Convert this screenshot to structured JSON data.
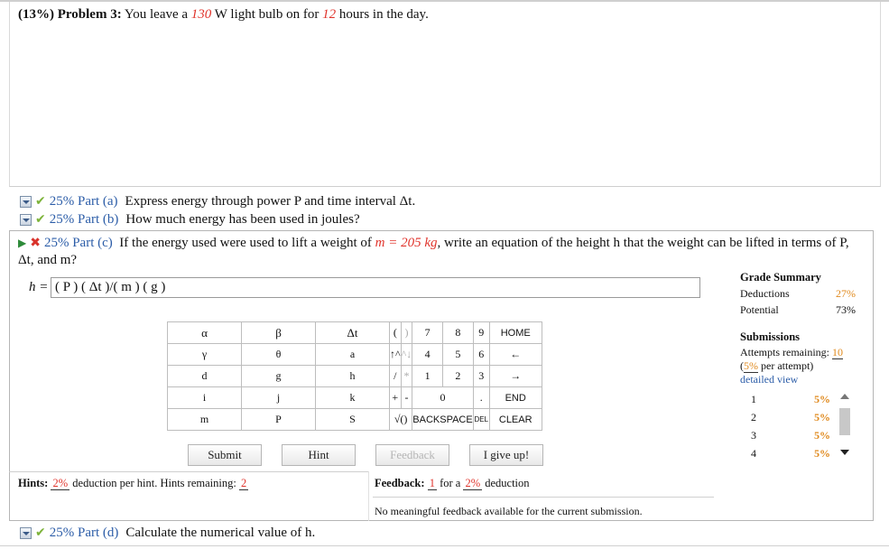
{
  "problem": {
    "label": "(13%) Problem 3:",
    "text_before": "You leave a",
    "power_value": "130",
    "text_mid": "W light bulb on for",
    "hours_value": "12",
    "text_after": "hours in the day."
  },
  "parts": {
    "a": {
      "pct": "25% Part (a)",
      "text": "Express energy through power P and time interval Δt."
    },
    "b": {
      "pct": "25% Part (b)",
      "text": "How much energy has been used in joules?"
    },
    "c": {
      "pct": "25% Part (c)",
      "text_before": "If the energy used were used to lift a weight of",
      "mass": "m = 205 kg",
      "text_after": ", write an equation of the height h that the weight can be lifted in terms of P, Δt, and m?"
    },
    "d": {
      "pct": "25% Part (d)",
      "text": "Calculate the numerical value of h."
    }
  },
  "answer": {
    "label": "h =",
    "value": "( P ) ( Δt )/( m ) ( g )"
  },
  "keypad": {
    "rows": [
      [
        "α",
        "β",
        "Δt",
        "(",
        ")",
        "7",
        "8",
        "9",
        "HOME"
      ],
      [
        "γ",
        "θ",
        "a",
        "↑^",
        "^↓",
        "4",
        "5",
        "6",
        "←"
      ],
      [
        "d",
        "g",
        "h",
        "/",
        "*",
        "1",
        "2",
        "3",
        "→"
      ],
      [
        "i",
        "j",
        "k",
        "+",
        "-",
        "0",
        ".",
        "END"
      ],
      [
        "m",
        "P",
        "S",
        "√()",
        "BACKSPACE",
        "DEL",
        "CLEAR"
      ]
    ]
  },
  "buttons": {
    "submit": "Submit",
    "hint": "Hint",
    "feedback": "Feedback",
    "give_up": "I give up!"
  },
  "hints": {
    "label": "Hints:",
    "pct": "2%",
    "mid": "deduction per hint. Hints remaining:",
    "remaining": "2"
  },
  "feedback": {
    "label": "Feedback:",
    "count": "1",
    "mid": "for a",
    "pct": "2%",
    "after": "deduction",
    "message": "No meaningful feedback available for the current submission."
  },
  "grade_summary": {
    "title": "Grade Summary",
    "deductions_label": "Deductions",
    "deductions_value": "27%",
    "potential_label": "Potential",
    "potential_value": "73%"
  },
  "submissions": {
    "title": "Submissions",
    "attempts_label": "Attempts remaining:",
    "attempts_value": "10",
    "per_attempt_pct": "5%",
    "per_attempt_text": "per attempt)",
    "open_paren": "(",
    "detailed": "detailed view",
    "list": [
      {
        "n": "1",
        "v": "5%"
      },
      {
        "n": "2",
        "v": "5%"
      },
      {
        "n": "3",
        "v": "5%"
      },
      {
        "n": "4",
        "v": "5%"
      }
    ]
  },
  "colors": {
    "accent_red": "#e0332b",
    "part_blue": "#2c5da8",
    "check_green": "#7db33a",
    "orange": "#e08a1e"
  }
}
